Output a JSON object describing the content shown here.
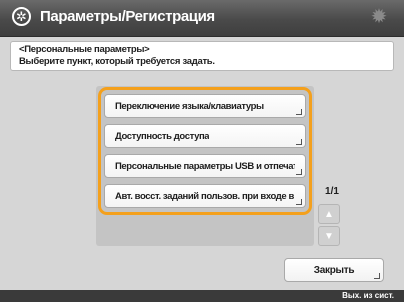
{
  "window": {
    "title": "Параметры/Регистрация",
    "title_icon": "gear-circle-icon",
    "settings_icon": "gear-icon"
  },
  "instruction": {
    "line1": "<Персональные параметры>",
    "line2": "Выберите пункт, который требуется задать."
  },
  "list": {
    "items": [
      {
        "label": "Переключение языка/клавиатуры"
      },
      {
        "label": "Доступность доступа"
      },
      {
        "label": "Персональные параметры USB и отпечатки пальцев"
      },
      {
        "label": "Авт. восст. заданий пользов. при входе в систему"
      }
    ],
    "page_indicator": "1/1",
    "scroll_up_icon": "triangle-up-icon",
    "scroll_down_icon": "triangle-down-icon"
  },
  "footer": {
    "close_label": "Закрыть"
  },
  "status": {
    "text": "Вых. из сист."
  },
  "colors": {
    "title_bar": "#4a4a4a",
    "selection_frame": "#f4a01c",
    "background": "#d6d6d6"
  }
}
